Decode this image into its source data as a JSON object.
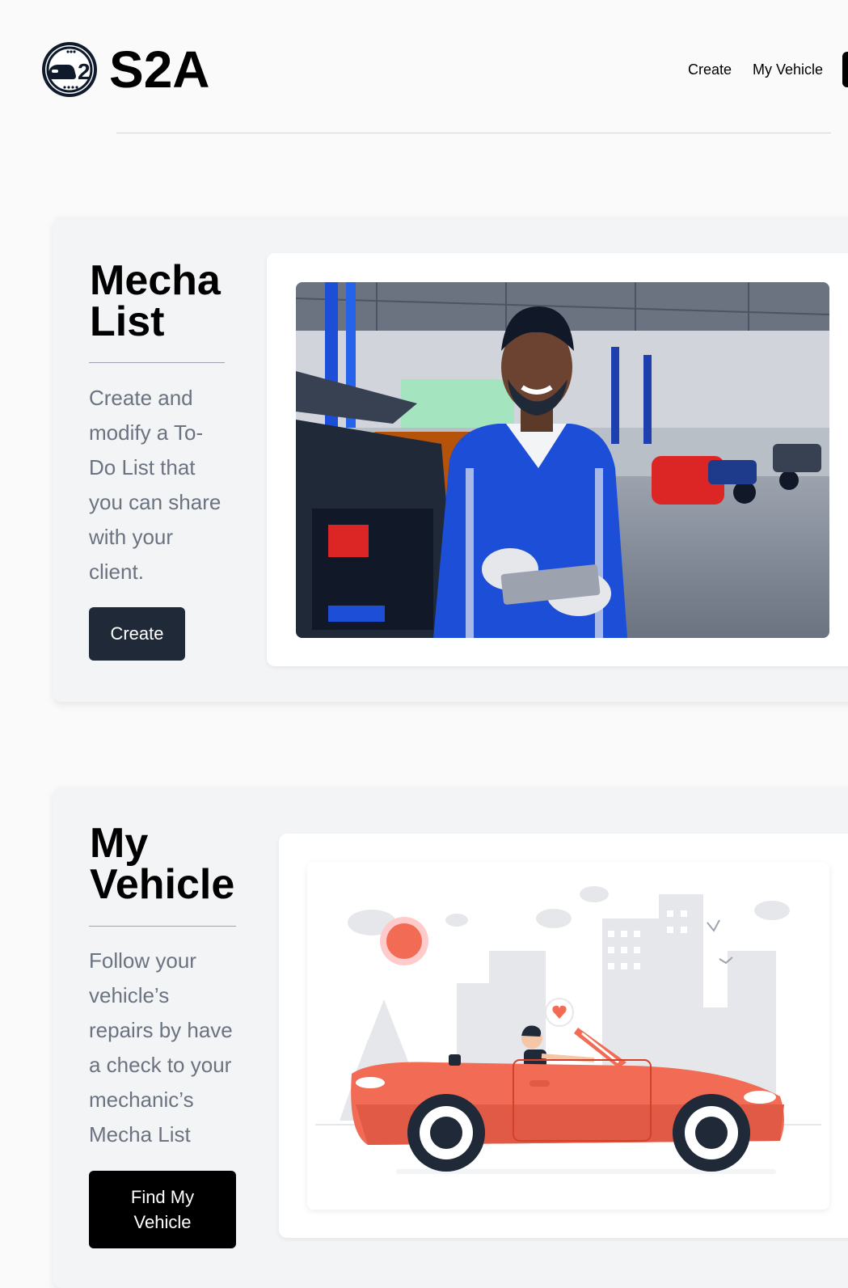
{
  "header": {
    "brand": "S2A",
    "logo_text": "2",
    "nav": [
      {
        "label": "Create"
      },
      {
        "label": "My Vehicle"
      }
    ]
  },
  "sections": [
    {
      "title_line1": "Mecha",
      "title_line2": "List",
      "desc_lines": [
        "Create and",
        "modify a To-",
        "Do List that",
        "you can share",
        "with your",
        "client."
      ],
      "button": "Create"
    },
    {
      "title_line1": "My",
      "title_line2": "Vehicle",
      "desc_lines": [
        "Follow your",
        "vehicle’s",
        "repairs by have",
        "a check to your",
        "mechanic’s",
        "Mecha List"
      ],
      "button_line1": "Find My",
      "button_line2": "Vehicle"
    }
  ],
  "colors": {
    "card_bg": "#f3f4f6",
    "dark_button": "#1f2937",
    "black_button": "#000000",
    "muted_text": "#6b7280",
    "car_red": "#f16b55"
  }
}
